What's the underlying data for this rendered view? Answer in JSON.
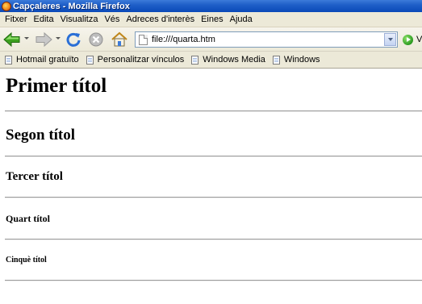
{
  "window": {
    "title": "Capçaleres - Mozilla Firefox"
  },
  "menu": {
    "items": [
      "Fitxer",
      "Edita",
      "Visualitza",
      "Vés",
      "Adreces d'interès",
      "Eines",
      "Ajuda"
    ]
  },
  "navbar": {
    "url": "file:///quarta.htm",
    "go_label": "V"
  },
  "bookmarks": {
    "items": [
      "Hotmail gratuïto",
      "Personalitzar vínculos",
      "Windows Media",
      "Windows"
    ]
  },
  "page": {
    "headings": [
      "Primer títol",
      "Segon títol",
      "Tercer títol",
      "Quart títol",
      "Cinquè títol"
    ]
  },
  "colors": {
    "titlebar": "#0a49b8",
    "chrome": "#ece9d8",
    "back_arrow": "#3ca01e",
    "reload": "#2a6fd6",
    "stop": "#a8a8a8",
    "home_roof": "#d9a32a"
  }
}
